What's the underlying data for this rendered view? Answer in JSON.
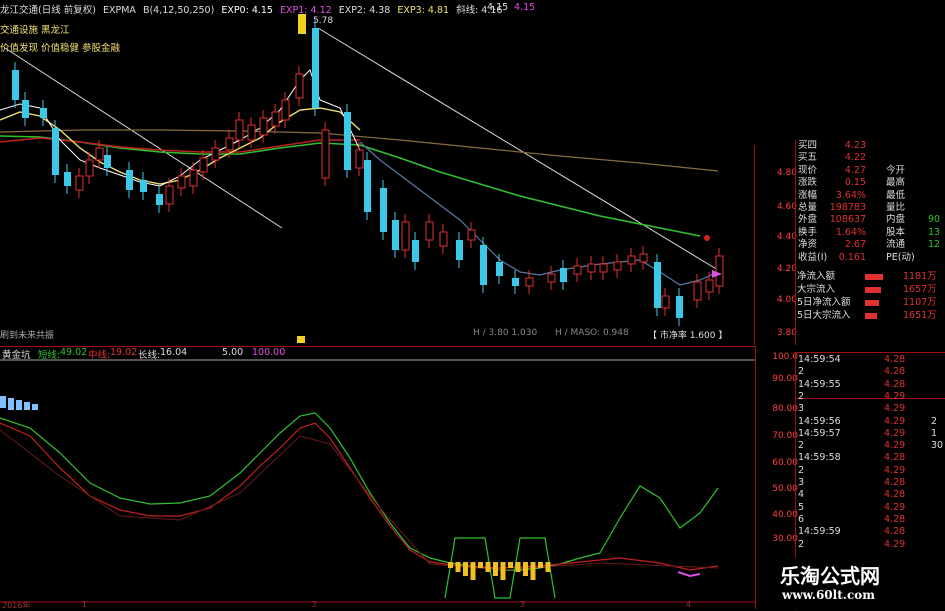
{
  "header": {
    "title": "龙江交通(日线 前复权)",
    "indicator": "EXPMA",
    "params": "B(4,12,50,250)",
    "exp0": "EXP0: 4.15",
    "exp1": "EXP1: 4.12",
    "exp2": "EXP2: 4.38",
    "exp3": "EXP3: 4.81",
    "slope": "斜线: 4.16",
    "right_val1": "4.15",
    "right_val2": "4.15"
  },
  "left_notes": {
    "line1": "交通设施 黑龙江",
    "line2": "价值发现 价值稳健 参股金融",
    "bottom_hint": "刷到未来共振"
  },
  "price_labels": {
    "high": "5.78",
    "hmaso": "H / MASO: 0.948",
    "h380": "H / 3.80 1.030",
    "ratio": "【 市净率 1.600 】"
  },
  "main_axis": [
    "4.80",
    "4.60",
    "4.40",
    "4.20",
    "4.00",
    "3.80"
  ],
  "sub_header": {
    "name": "黄金坑",
    "short_label": "短线:",
    "short_val": "49.02",
    "mid_label": "中线:",
    "mid_val": "19.02",
    "long_label": "长线:",
    "long_val": "16.04",
    "v5": "5.00",
    "v100": "100.00"
  },
  "sub_axis": [
    "100.0",
    "90.00",
    "80.00",
    "70.00",
    "60.00",
    "50.00",
    "40.00",
    "30.00"
  ],
  "quote": [
    {
      "label": "买四",
      "value": "4.23",
      "label2": "",
      "value2": ""
    },
    {
      "label": "买五",
      "value": "4.22",
      "label2": "",
      "value2": ""
    },
    {
      "label": "现价",
      "value": "4.27",
      "label2": "今开",
      "value2": ""
    },
    {
      "label": "涨跌",
      "value": "0.15",
      "label2": "最高",
      "value2": ""
    },
    {
      "label": "涨幅",
      "value": "3.64%",
      "label2": "最低",
      "value2": ""
    },
    {
      "label": "总量",
      "value": "198783",
      "label2": "量比",
      "value2": ""
    },
    {
      "label": "外盘",
      "value": "108637",
      "label2": "内盘",
      "value2": "90"
    },
    {
      "label": "换手",
      "value": "1.64%",
      "label2": "股本",
      "value2": "13"
    },
    {
      "label": "净资",
      "value": "2.67",
      "label2": "流通",
      "value2": "12"
    },
    {
      "label": "收益(I)",
      "value": "0.161",
      "label2": "PE(动)",
      "value2": ""
    }
  ],
  "capital_flow": [
    {
      "label": "净流入额",
      "value": "1181万"
    },
    {
      "label": "大宗流入",
      "value": "1657万"
    },
    {
      "label": "5日净流入额",
      "value": "1107万"
    },
    {
      "label": "5日大宗流入",
      "value": "1651万"
    }
  ],
  "ticks": [
    {
      "t": "14:59:54",
      "p": "4.28",
      "v": ""
    },
    {
      "t": "2",
      "p": "4.28",
      "v": ""
    },
    {
      "t": "14:59:55",
      "p": "4.28",
      "v": ""
    },
    {
      "t": "2",
      "p": "4.29",
      "v": ""
    },
    {
      "t": "3",
      "p": "4.29",
      "v": ""
    },
    {
      "t": "14:59:56",
      "p": "4.29",
      "v": "2"
    },
    {
      "t": "14:59:57",
      "p": "4.29",
      "v": "1"
    },
    {
      "t": "2",
      "p": "4.29",
      "v": "30"
    },
    {
      "t": "14:59:58",
      "p": "4.28",
      "v": ""
    },
    {
      "t": "2",
      "p": "4.29",
      "v": ""
    },
    {
      "t": "3",
      "p": "4.28",
      "v": ""
    },
    {
      "t": "4",
      "p": "4.28",
      "v": ""
    },
    {
      "t": "5",
      "p": "4.29",
      "v": ""
    },
    {
      "t": "6",
      "p": "4.28",
      "v": ""
    },
    {
      "t": "14:59:59",
      "p": "4.28",
      "v": ""
    },
    {
      "t": "2",
      "p": "4.29",
      "v": ""
    }
  ],
  "watermark": {
    "cn": "乐淘公式网",
    "url": "www.60lt.com"
  },
  "x_axis": [
    "2016年",
    "1",
    "2",
    "3",
    "4"
  ],
  "colors": {
    "up": "#e03030",
    "down": "#3cc8e8",
    "ma_white": "#ffffff",
    "ma_yellow": "#f0e070",
    "ma_green": "#30c030",
    "ma_red": "#c02020",
    "ma_brown": "#8a6a40",
    "axis_red": "#a01010"
  }
}
